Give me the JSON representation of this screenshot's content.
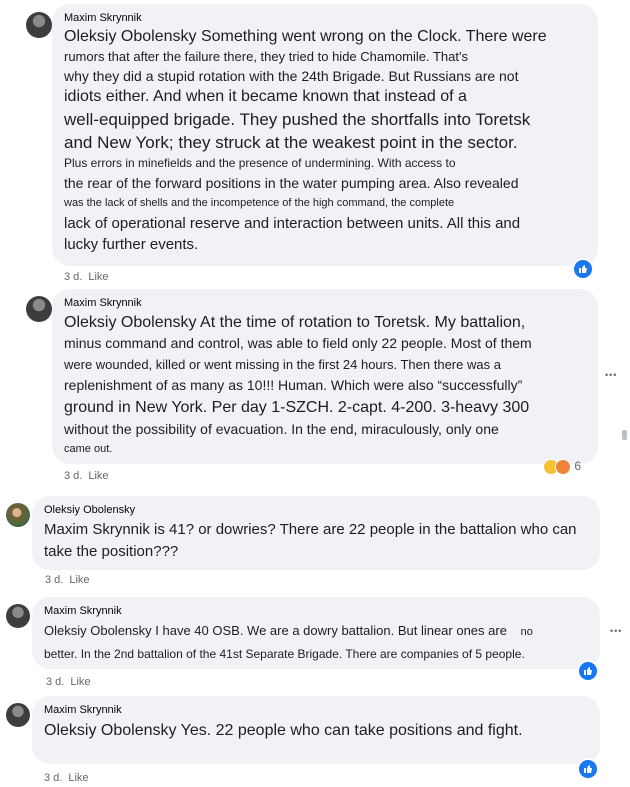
{
  "comments": [
    {
      "author": "Maxim Skrynnik",
      "lines": [
        "Oleksiy Obolensky Something went wrong on the Clock. There were",
        "rumors that after the failure there, they tried to hide Chamomile. That's",
        "why they did a stupid rotation with the 24th Brigade. But Russians are not",
        "idiots either. And when it became known that instead of a",
        "well-equipped brigade. They pushed the shortfalls into Toretsk",
        "and New York; they struck at the weakest point in the sector.",
        "Plus errors in minefields and the presence of undermining. With access to",
        "the rear of the forward positions in the water pumping area. Also revealed",
        "was the lack of shells and the incompetence of the high command, the complete",
        "lack of operational reserve and interaction between units. All this and",
        "lucky further events."
      ],
      "time": "3 d.",
      "like": "Like"
    },
    {
      "author": "Maxim Skrynnik",
      "lines": [
        "Oleksiy Obolensky At the time of rotation to Toretsk. My battalion,",
        "minus command and control, was able to field only 22 people. Most of them",
        "were wounded, killed or went missing in the first 24 hours. Then there was a",
        "replenishment of as many as 10!!! Human. Which were also “successfully”",
        "ground in New York. Per day 1-SZCH. 2-capt. 4-200. 3-heavy 300",
        "without the possibility of evacuation. In the end, miraculously, only one",
        "came out."
      ],
      "time": "3 d.",
      "like": "Like",
      "reactions_count": "6"
    },
    {
      "author": "Oleksiy Obolensky",
      "lines": [
        "Maxim Skrynnik is 41? or dowries? There are 22 people in the battalion who can",
        "take the position???"
      ],
      "time": "3 d.",
      "like": "Like"
    },
    {
      "author": "Maxim Skrynnik",
      "lines": [
        "Oleksiy Obolensky I have 40 OSB. We are a dowry battalion. But linear ones are",
        "better. In the 2nd battalion of the 41st Separate Brigade. There are companies of 5 people."
      ],
      "extra_word": "no",
      "time": "3 d.",
      "like": "Like"
    },
    {
      "author": "Maxim Skrynnik",
      "lines": [
        "Oleksiy Obolensky Yes. 22 people who can take positions and fight."
      ],
      "time": "3 d.",
      "like": "Like"
    }
  ],
  "more_options": "•••",
  "colors": {
    "bubble": "#f0f2f5",
    "like_blue": "#1877f2",
    "meta_gray": "#65676b"
  }
}
